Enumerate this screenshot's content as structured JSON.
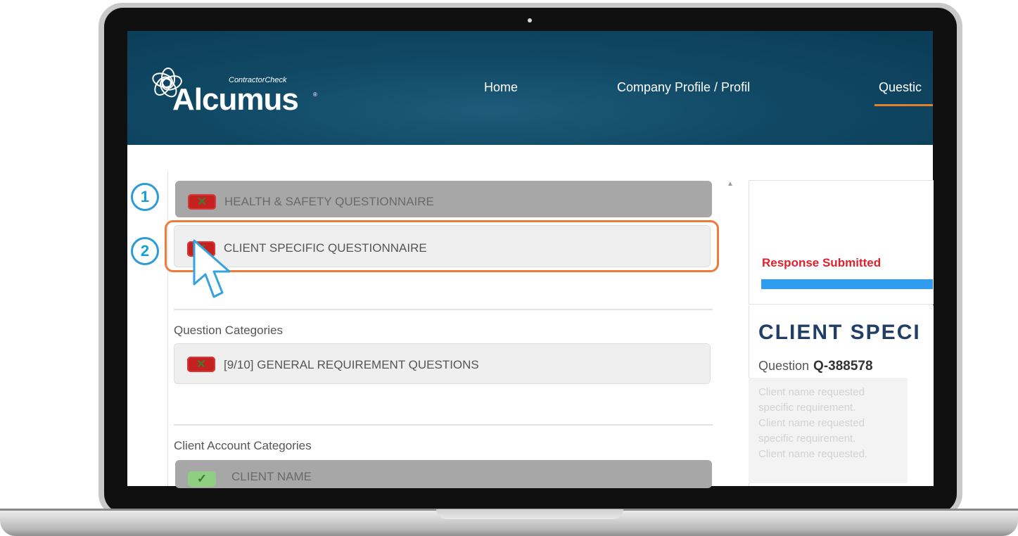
{
  "brand": {
    "tagline": "ContractorCheck",
    "name": "Alcumus",
    "reg_mark": "®"
  },
  "nav": {
    "items": [
      {
        "label": "Home"
      },
      {
        "label": "Company Profile / Profil"
      },
      {
        "label": "Questic",
        "active": true
      }
    ],
    "active_color": "#e87f2e"
  },
  "questionnaires": [
    {
      "label": "HEALTH & SAFETY QUESTIONNAIRE",
      "status": "x-icon"
    },
    {
      "label": "CLIENT SPECIFIC QUESTIONNAIRE",
      "status": "x-icon",
      "highlighted": true
    }
  ],
  "question_categories": {
    "heading": "Question Categories",
    "items": [
      {
        "label": "[9/10] GENERAL REQUIREMENT QUESTIONS",
        "status": "x-icon"
      }
    ]
  },
  "client_account_categories": {
    "heading": "Client Account Categories",
    "items": [
      {
        "label": "CLIENT NAME",
        "status": "check-icon"
      }
    ]
  },
  "detail": {
    "response_status": "Response Submitted",
    "title": "CLIENT SPECI",
    "question_label": "Question",
    "question_id": "Q-388578",
    "description_lines": [
      "Client name requested",
      "specific requirement.",
      "Client name requested",
      "specific requirement.",
      "Client name requested."
    ]
  },
  "steps": [
    {
      "number": "1"
    },
    {
      "number": "2"
    }
  ],
  "colors": {
    "header": "#104965",
    "status_fail": "#c52121",
    "status_pass": "#8fcf84",
    "highlight": "#ee7b3c",
    "step_marker": "#2d9bd7",
    "response_text": "#e0212b",
    "progress": "#2e9df0"
  }
}
